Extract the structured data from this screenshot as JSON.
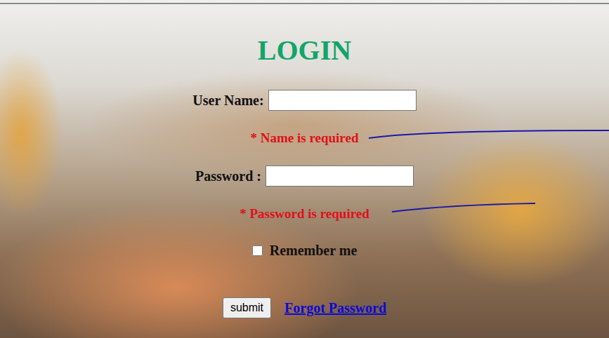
{
  "title": "LOGIN",
  "fields": [
    {
      "label": "User Name:",
      "value": "",
      "error": "* Name is required"
    },
    {
      "label": "Password :",
      "value": "",
      "error": "* Password is required"
    }
  ],
  "remember": {
    "label": "Remember me",
    "checked": false
  },
  "submit": "submit",
  "forgot": "Forgot Password"
}
